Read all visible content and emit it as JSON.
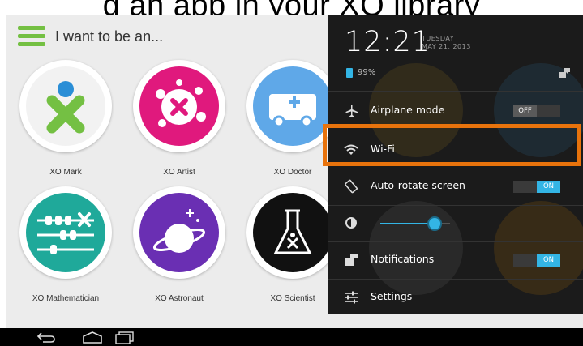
{
  "overlay_caption": "g an app in your XO library",
  "app": {
    "title": "I want to be an..."
  },
  "tiles": [
    {
      "label": "XO Mark"
    },
    {
      "label": "XO Artist"
    },
    {
      "label": "XO Doctor"
    },
    {
      "label": "XO Mathematician"
    },
    {
      "label": "XO Astronaut"
    },
    {
      "label": "XO Scientist"
    }
  ],
  "quick_settings": {
    "time": "12:21",
    "day": "TUESDAY",
    "date": "MAY 21, 2013",
    "battery": "99%",
    "rows": [
      {
        "label": "Airplane mode",
        "toggle": "OFF"
      },
      {
        "label": "Wi-Fi"
      },
      {
        "label": "Auto-rotate screen",
        "toggle": "ON"
      },
      {
        "label": "Brightness",
        "brightness_level": 0.78
      },
      {
        "label": "Notifications",
        "toggle": "ON"
      },
      {
        "label": "Settings"
      }
    ]
  },
  "colors": {
    "accent_highlight": "#e8730c",
    "toggle_on": "#33b5e5",
    "brand_green": "#74c043"
  }
}
